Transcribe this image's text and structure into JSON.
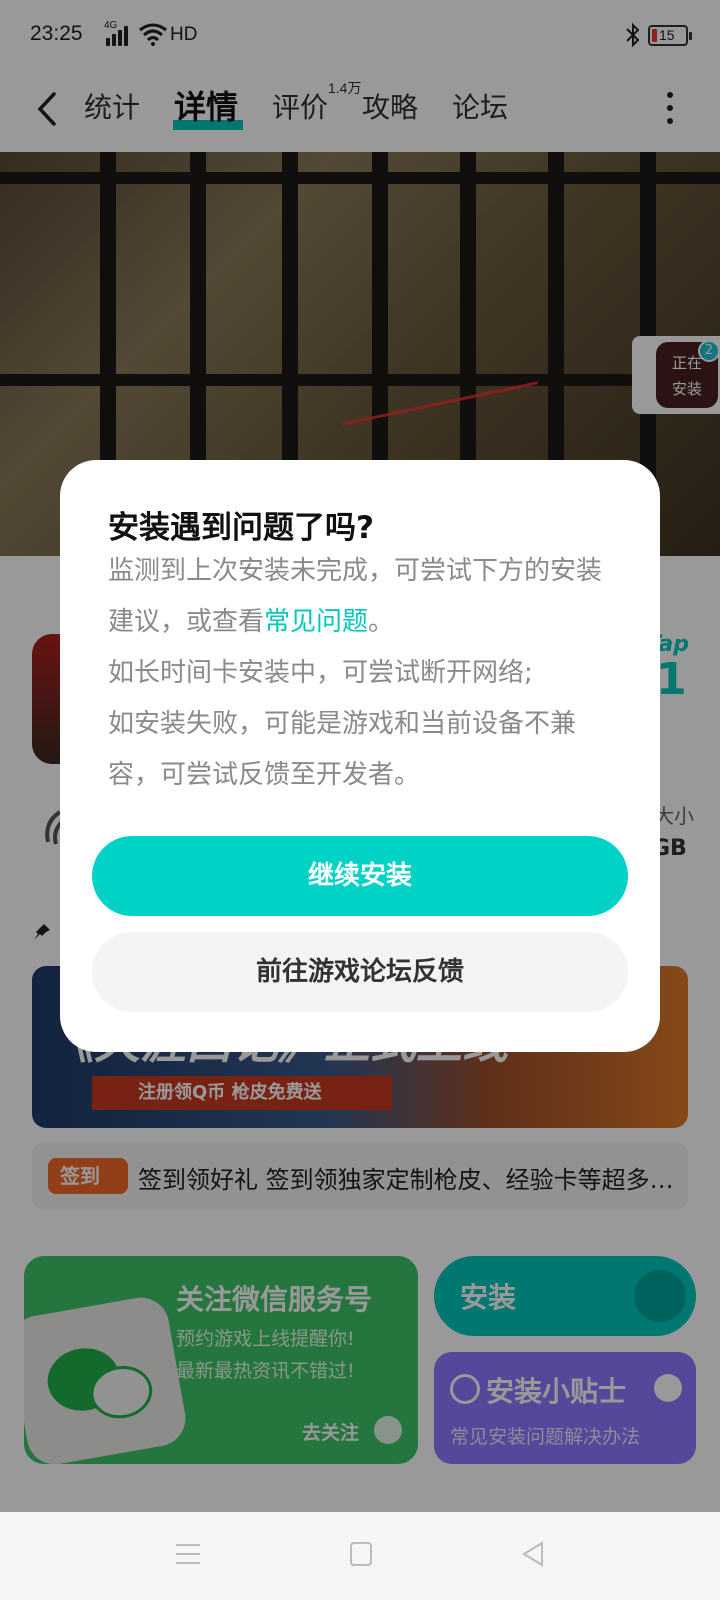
{
  "status_bar": {
    "time": "23:25",
    "network": "4G",
    "hd": "HD",
    "battery": "15"
  },
  "nav": {
    "tabs": [
      "统计",
      "详情",
      "评价",
      "攻略",
      "论坛"
    ],
    "active_tab": "详情",
    "review_count": "1.4万"
  },
  "installing_widget": {
    "line1": "正在",
    "line2": "安装",
    "badge": "2"
  },
  "game": {
    "taptap_label": "Tap",
    "score_partial": "1",
    "size_label": "大小",
    "size_value": "GB"
  },
  "banner": {
    "title": "《天涯西记》正式上线",
    "subtitle": "注册领Q币   枪皮免费送"
  },
  "signin": {
    "tag": "签到",
    "text": "签到领好礼 签到领独家定制枪皮、经验卡等超多…"
  },
  "wechat_card": {
    "title": "关注微信服务号",
    "line1": "预约游戏上线提醒你!",
    "line2": "最新最热资讯不错过!",
    "follow": "去关注"
  },
  "install_button": {
    "label": "安装"
  },
  "tips_card": {
    "title": "安装小贴士",
    "subtitle": "常见安装问题解决办法"
  },
  "dialog": {
    "title": "安装遇到问题了吗?",
    "body_part1": "监测到上次安装未完成，可尝试下方的安装建议，或查看",
    "faq_link": "常见问题",
    "body_part2": "。",
    "line_network": "如长时间卡安装中，可尝试断开网络;",
    "line_compat": "如安装失败，可能是游戏和当前设备不兼容，可尝试反馈至开发者。",
    "continue_button": "继续安装",
    "forum_button": "前往游戏论坛反馈"
  },
  "colors": {
    "accent": "#00d2c5",
    "link": "#00c9bd",
    "wechat_green": "#3fc36a",
    "tips_purple": "#8a78ff",
    "signin_orange": "#f36a2a"
  }
}
